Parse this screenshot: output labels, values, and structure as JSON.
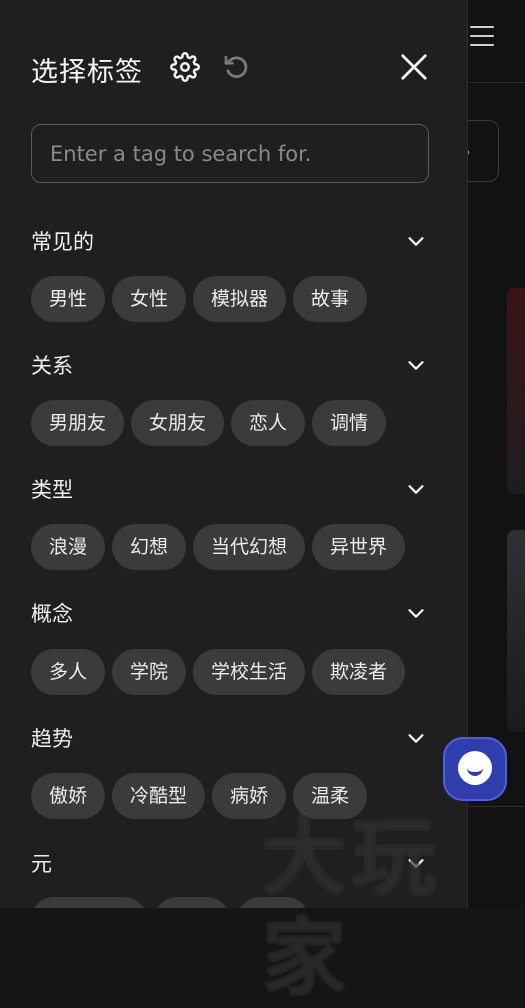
{
  "drawer": {
    "title": "选择标签",
    "search_placeholder": "Enter a tag to search for."
  },
  "sections": [
    {
      "title": "常见的",
      "tags": [
        "男性",
        "女性",
        "模拟器",
        "故事"
      ]
    },
    {
      "title": "关系",
      "tags": [
        "男朋友",
        "女朋友",
        "恋人",
        "调情"
      ]
    },
    {
      "title": "类型",
      "tags": [
        "浪漫",
        "幻想",
        "当代幻想",
        "异世界"
      ]
    },
    {
      "title": "概念",
      "tags": [
        "多人",
        "学院",
        "学校生活",
        "欺凌者"
      ]
    },
    {
      "title": "趋势",
      "tags": [
        "傲娇",
        "冷酷型",
        "病娇",
        "温柔"
      ]
    },
    {
      "title": "元",
      "tags": [
        "",
        "",
        ""
      ]
    }
  ],
  "icons": {
    "settings": "gear-icon",
    "reset": "reset-icon",
    "close": "close-icon",
    "expand": "chevron-down-icon",
    "chat": "chat-bubble-icon"
  },
  "watermark": "大玩家",
  "colors": {
    "drawer_bg": "#1f1f21",
    "chip_bg": "#3b3b3d",
    "fab_bg": "#2f3dad"
  }
}
